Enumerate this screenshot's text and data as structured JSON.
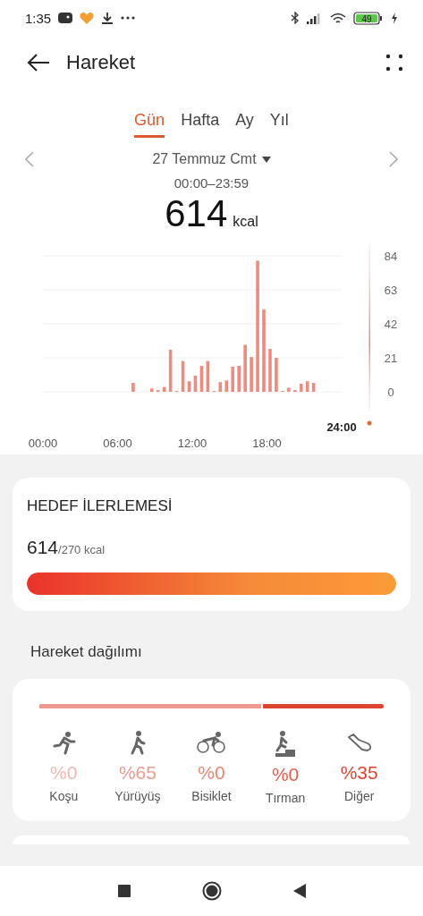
{
  "status_bar": {
    "time": "1:35",
    "battery": "49"
  },
  "header": {
    "title": "Hareket"
  },
  "tabs": [
    {
      "label": "Gün",
      "selected": true
    },
    {
      "label": "Hafta",
      "selected": false
    },
    {
      "label": "Ay",
      "selected": false
    },
    {
      "label": "Yıl",
      "selected": false
    }
  ],
  "date": "27 Temmuz Cmt",
  "time_range": "00:00–23:59",
  "total": {
    "value": "614",
    "unit": "kcal"
  },
  "chart_data": {
    "type": "bar",
    "x": [
      7.25,
      8.75,
      9.25,
      9.75,
      10.25,
      10.75,
      11.25,
      11.75,
      12.25,
      12.75,
      13.25,
      13.75,
      14.25,
      14.75,
      15.25,
      15.75,
      16.25,
      16.75,
      17.25,
      17.75,
      18.25,
      18.75,
      19.25,
      19.75,
      20.25,
      20.75,
      21.25,
      21.75
    ],
    "series": [
      {
        "color": "#ee8a7e",
        "values": [
          5.5,
          2,
          1,
          3,
          26,
          0.5,
          19,
          6.5,
          10,
          16,
          19,
          0.5,
          6,
          7,
          15.5,
          16,
          29,
          21.5,
          81,
          51,
          26.5,
          21,
          0.5,
          2.5,
          1,
          5,
          6.5,
          5.5
        ]
      }
    ],
    "xlim": [
      0,
      24
    ],
    "ylim": [
      0,
      84
    ],
    "xticks": [
      {
        "value": 0,
        "label": "00:00"
      },
      {
        "value": 6,
        "label": "06:00"
      },
      {
        "value": 12,
        "label": "12:00"
      },
      {
        "value": 18,
        "label": "18:00"
      }
    ],
    "annotations": [
      "24:00"
    ],
    "yticks": [
      0,
      21,
      42,
      63,
      84
    ],
    "grid": true
  },
  "goal": {
    "title": "HEDEF İLERLEMESİ",
    "value": "614",
    "target": "/270 kcal",
    "level": 1
  },
  "distribution": {
    "title": "Hareket dağılımı",
    "bar": {
      "level": 0.65
    },
    "items": [
      {
        "kind": "run",
        "percent": "%0",
        "label": "Koşu",
        "color": "#f2b8b0"
      },
      {
        "kind": "walk",
        "percent": "%65",
        "label": "Yürüyüş",
        "color": "#ef9a8e"
      },
      {
        "kind": "bike",
        "percent": "%0",
        "label": "Bisiklet",
        "color": "#ec8373"
      },
      {
        "kind": "climb",
        "percent": "%0",
        "label": "Tırman",
        "color": "#e4604c"
      },
      {
        "kind": "other",
        "percent": "%35",
        "label": "Diğer",
        "color": "#dc4630"
      }
    ]
  }
}
